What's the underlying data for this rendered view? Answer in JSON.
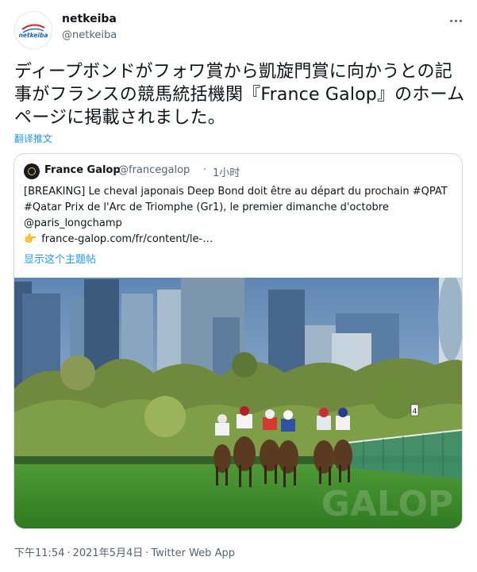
{
  "author": {
    "name": "netkeiba",
    "handle": "@netkeiba",
    "logo_text": "netkeiba"
  },
  "tweet": {
    "text": "ディープボンドがフォワ賞から凱旋門賞に向かうとの記事がフランスの競馬統括機関『France Galop』のホームページに掲載されました。",
    "translate_label": "翻译推文"
  },
  "quoted": {
    "name": "France Galop",
    "handle": "@francegalop",
    "separator": "·",
    "time": "1小时",
    "text": "[BREAKING] Le cheval japonais Deep Bond doit être au départ du prochain #QPAT #Qatar Prix de l'Arc de Triomphe (Gr1), le premier dimanche d'octobre @paris_longchamp",
    "link_emoji": "👉",
    "link_text": "france-galop.com/fr/content/le-…",
    "show_thread": "显示这个主题帖",
    "image_watermark": "GALOP"
  },
  "footer": {
    "time": "下午11:54",
    "separator": "·",
    "date": "2021年5月4日",
    "source": "Twitter Web App"
  },
  "colors": {
    "link": "#1d9bf0",
    "secondary_text": "#536471",
    "logo_red": "#d32f2f",
    "logo_blue": "#1565c0"
  }
}
